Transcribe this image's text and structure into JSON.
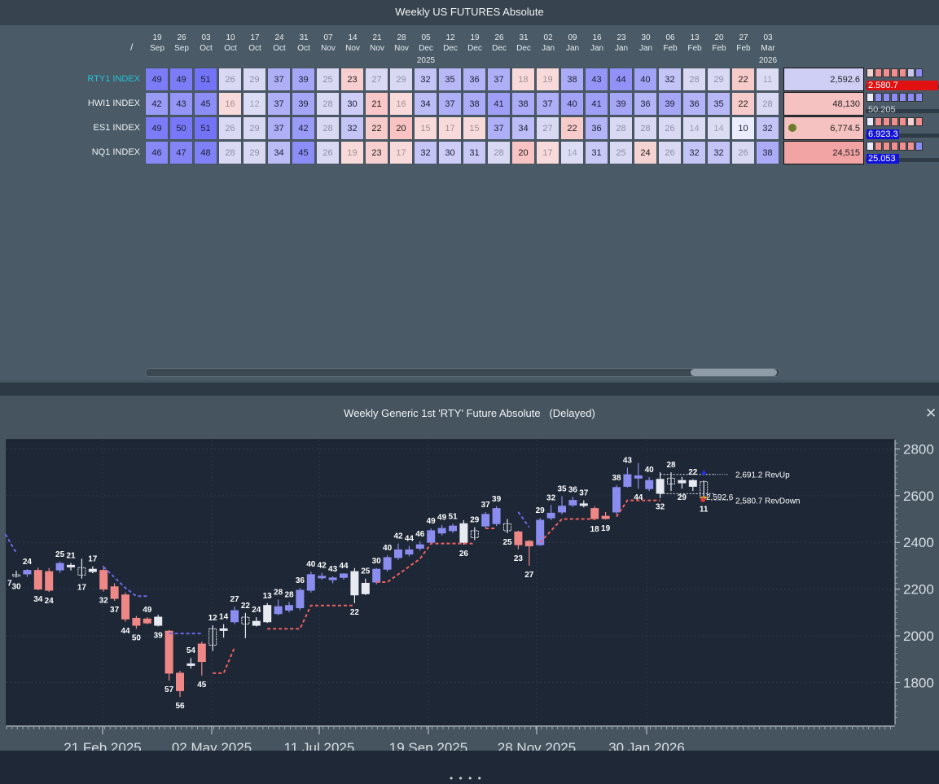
{
  "grid_title": "Weekly US FUTURES Absolute",
  "slash": "/",
  "columns": [
    {
      "day": "19",
      "mon": "Sep"
    },
    {
      "day": "26",
      "mon": "Sep"
    },
    {
      "day": "03",
      "mon": "Oct"
    },
    {
      "day": "10",
      "mon": "Oct"
    },
    {
      "day": "17",
      "mon": "Oct"
    },
    {
      "day": "24",
      "mon": "Oct"
    },
    {
      "day": "31",
      "mon": "Oct"
    },
    {
      "day": "07",
      "mon": "Nov"
    },
    {
      "day": "14",
      "mon": "Nov"
    },
    {
      "day": "21",
      "mon": "Nov"
    },
    {
      "day": "28",
      "mon": "Nov"
    },
    {
      "day": "05",
      "mon": "Dec"
    },
    {
      "day": "12",
      "mon": "Dec"
    },
    {
      "day": "19",
      "mon": "Dec"
    },
    {
      "day": "26",
      "mon": "Dec"
    },
    {
      "day": "31",
      "mon": "Dec"
    },
    {
      "day": "02",
      "mon": "Jan"
    },
    {
      "day": "09",
      "mon": "Jan"
    },
    {
      "day": "16",
      "mon": "Jan"
    },
    {
      "day": "23",
      "mon": "Jan"
    },
    {
      "day": "30",
      "mon": "Jan"
    },
    {
      "day": "06",
      "mon": "Feb"
    },
    {
      "day": "13",
      "mon": "Feb"
    },
    {
      "day": "20",
      "mon": "Feb"
    },
    {
      "day": "27",
      "mon": "Feb"
    },
    {
      "day": "03",
      "mon": "Mar"
    }
  ],
  "year_labels": [
    {
      "col": 11,
      "text": "2025"
    },
    {
      "col": 25,
      "text": "2026"
    }
  ],
  "rows": [
    {
      "name": "RTY1 INDEX",
      "highlight": true,
      "values": [
        49,
        49,
        51,
        26,
        29,
        37,
        39,
        25,
        23,
        27,
        29,
        32,
        35,
        36,
        37,
        18,
        19,
        38,
        43,
        44,
        40,
        32,
        28,
        29,
        22,
        11
      ],
      "last": "2,592.6",
      "sub": "2.580.7",
      "sub_bg": "#e11111",
      "mini": [
        "#f3d2d2",
        "#ef8f8f",
        "#ef8f8f",
        "#ef8f8f",
        "#ef8f8f",
        "#c8c8ee",
        "#8c8cf2"
      ],
      "dot": false,
      "box_bg": "#cfcff5"
    },
    {
      "name": "HWI1 INDEX",
      "highlight": false,
      "values": [
        42,
        43,
        45,
        16,
        12,
        37,
        39,
        28,
        30,
        21,
        16,
        34,
        37,
        38,
        41,
        38,
        37,
        40,
        41,
        39,
        36,
        39,
        36,
        35,
        22,
        28
      ],
      "last": "48,130",
      "sub": "50.205",
      "sub_bg": "",
      "mini": [
        "#ebebff",
        "#8c8cf2",
        "#8c8cf2",
        "#8c8cf2",
        "#8c8cf2",
        "#8c8cf2",
        "#8c8cf2"
      ],
      "dot": false,
      "box_bg": "#f6c1c1"
    },
    {
      "name": "ES1 INDEX",
      "highlight": false,
      "values": [
        49,
        50,
        51,
        26,
        29,
        37,
        42,
        28,
        32,
        22,
        20,
        15,
        17,
        15,
        37,
        34,
        27,
        22,
        36,
        28,
        28,
        26,
        14,
        14,
        10,
        32
      ],
      "last": "6,774.5",
      "sub": "6.923.3",
      "sub_bg": "#1111dd",
      "mini": [
        "#ebebff",
        "#ef8f8f",
        "#ef8f8f",
        "#ef8f8f",
        "#ef8f8f",
        "#f3d2d2",
        "#ef8f8f"
      ],
      "dot": true,
      "box_bg": "#f6c1c1"
    },
    {
      "name": "NQ1 INDEX",
      "highlight": false,
      "values": [
        46,
        47,
        48,
        28,
        29,
        34,
        45,
        26,
        19,
        23,
        17,
        32,
        30,
        31,
        28,
        20,
        17,
        14,
        31,
        25,
        24,
        26,
        32,
        32,
        26,
        38
      ],
      "last": "24,515",
      "sub": "25.053",
      "sub_bg": "#1111dd",
      "mini": [
        "#ebebff",
        "#ef8f8f",
        "#ef8f8f",
        "#ef8f8f",
        "#ef8f8f",
        "#ef8f8f",
        "#8c8cf2"
      ],
      "dot": false,
      "box_bg": "#f2a3a3"
    }
  ],
  "chart_title": "Weekly Generic 1st 'RTY' Future Absolute   (Delayed)",
  "close_glyph": "✕",
  "chart_data": {
    "type": "candlestick",
    "ylim": [
      1620,
      2840
    ],
    "yticks": [
      1800,
      2000,
      2200,
      2400,
      2600,
      2800
    ],
    "xticks": [
      "21 Feb 2025",
      "02 May 2025",
      "11 Jul 2025",
      "19 Sep 2025",
      "28 Nov 2025",
      "30 Jan 2026"
    ],
    "candles": [
      {
        "o": 2262,
        "h": 2278,
        "l": 2250,
        "c": 2258,
        "col": "w",
        "lbl": "30"
      },
      {
        "o": 2265,
        "h": 2285,
        "l": 2252,
        "c": 2280,
        "col": "p",
        "lbl": "24"
      },
      {
        "o": 2280,
        "h": 2292,
        "l": 2195,
        "c": 2200,
        "col": "r",
        "lbl": "34"
      },
      {
        "o": 2275,
        "h": 2290,
        "l": 2188,
        "c": 2195,
        "col": "r",
        "lbl": "24"
      },
      {
        "o": 2282,
        "h": 2318,
        "l": 2270,
        "c": 2310,
        "col": "p",
        "lbl": "25"
      },
      {
        "o": 2298,
        "h": 2312,
        "l": 2280,
        "c": 2302,
        "col": "w",
        "lbl": "21"
      },
      {
        "o": 2292,
        "h": 2330,
        "l": 2245,
        "c": 2260,
        "col": "w",
        "lbl": "17"
      },
      {
        "o": 2275,
        "h": 2298,
        "l": 2268,
        "c": 2285,
        "col": "w",
        "lbl": "17"
      },
      {
        "o": 2280,
        "h": 2300,
        "l": 2190,
        "c": 2200,
        "col": "r",
        "lbl": "32"
      },
      {
        "o": 2210,
        "h": 2225,
        "l": 2150,
        "c": 2160,
        "col": "r",
        "lbl": "37"
      },
      {
        "o": 2175,
        "h": 2185,
        "l": 2060,
        "c": 2072,
        "col": "r",
        "lbl": "44"
      },
      {
        "o": 2075,
        "h": 2085,
        "l": 2030,
        "c": 2045,
        "col": "r",
        "lbl": "50"
      },
      {
        "o": 2055,
        "h": 2080,
        "l": 2050,
        "c": 2072,
        "col": "r",
        "lbl": "49"
      },
      {
        "o": 2080,
        "h": 2090,
        "l": 2040,
        "c": 2045,
        "col": "w",
        "lbl": "39"
      },
      {
        "o": 2020,
        "h": 2025,
        "l": 1808,
        "c": 1840,
        "col": "r",
        "lbl": "57"
      },
      {
        "o": 1840,
        "h": 1850,
        "l": 1738,
        "c": 1765,
        "col": "r",
        "lbl": "56"
      },
      {
        "o": 1880,
        "h": 1905,
        "l": 1860,
        "c": 1880,
        "col": "w",
        "lbl": "54"
      },
      {
        "o": 1965,
        "h": 1975,
        "l": 1830,
        "c": 1890,
        "col": "r",
        "lbl": "45"
      },
      {
        "o": 1960,
        "h": 2045,
        "l": 1935,
        "c": 2030,
        "col": "w",
        "lbl": "12"
      },
      {
        "o": 2030,
        "h": 2050,
        "l": 1992,
        "c": 2030,
        "col": "w",
        "lbl": "14"
      },
      {
        "o": 2060,
        "h": 2125,
        "l": 2050,
        "c": 2108,
        "col": "p",
        "lbl": "27"
      },
      {
        "o": 2050,
        "h": 2098,
        "l": 1990,
        "c": 2080,
        "col": "w",
        "lbl": "22"
      },
      {
        "o": 2045,
        "h": 2080,
        "l": 2040,
        "c": 2062,
        "col": "w",
        "lbl": "24"
      },
      {
        "o": 2060,
        "h": 2140,
        "l": 2055,
        "c": 2130,
        "col": "w",
        "lbl": "13"
      },
      {
        "o": 2095,
        "h": 2155,
        "l": 2088,
        "c": 2125,
        "col": "p",
        "lbl": "28"
      },
      {
        "o": 2110,
        "h": 2145,
        "l": 2100,
        "c": 2130,
        "col": "p",
        "lbl": "28"
      },
      {
        "o": 2120,
        "h": 2205,
        "l": 2110,
        "c": 2195,
        "col": "p",
        "lbl": "36"
      },
      {
        "o": 2195,
        "h": 2275,
        "l": 2185,
        "c": 2262,
        "col": "p",
        "lbl": "40"
      },
      {
        "o": 2250,
        "h": 2270,
        "l": 2240,
        "c": 2255,
        "col": "p",
        "lbl": "42"
      },
      {
        "o": 2240,
        "h": 2255,
        "l": 2225,
        "c": 2248,
        "col": "p",
        "lbl": "43"
      },
      {
        "o": 2250,
        "h": 2268,
        "l": 2240,
        "c": 2265,
        "col": "p",
        "lbl": "44"
      },
      {
        "o": 2275,
        "h": 2290,
        "l": 2140,
        "c": 2175,
        "col": "w",
        "lbl": "22"
      },
      {
        "o": 2180,
        "h": 2245,
        "l": 2175,
        "c": 2225,
        "col": "w",
        "lbl": "25"
      },
      {
        "o": 2230,
        "h": 2290,
        "l": 2220,
        "c": 2285,
        "col": "p",
        "lbl": "30"
      },
      {
        "o": 2285,
        "h": 2345,
        "l": 2275,
        "c": 2335,
        "col": "p",
        "lbl": "40"
      },
      {
        "o": 2335,
        "h": 2395,
        "l": 2325,
        "c": 2368,
        "col": "p",
        "lbl": "42"
      },
      {
        "o": 2350,
        "h": 2385,
        "l": 2340,
        "c": 2368,
        "col": "p",
        "lbl": "44"
      },
      {
        "o": 2375,
        "h": 2405,
        "l": 2365,
        "c": 2390,
        "col": "p",
        "lbl": "46"
      },
      {
        "o": 2400,
        "h": 2460,
        "l": 2395,
        "c": 2450,
        "col": "p",
        "lbl": "49"
      },
      {
        "o": 2440,
        "h": 2475,
        "l": 2430,
        "c": 2460,
        "col": "p",
        "lbl": "49"
      },
      {
        "o": 2450,
        "h": 2480,
        "l": 2440,
        "c": 2470,
        "col": "p",
        "lbl": "51"
      },
      {
        "o": 2480,
        "h": 2495,
        "l": 2390,
        "c": 2400,
        "col": "w",
        "lbl": "26"
      },
      {
        "o": 2420,
        "h": 2465,
        "l": 2410,
        "c": 2450,
        "col": "w",
        "lbl": "29"
      },
      {
        "o": 2470,
        "h": 2530,
        "l": 2460,
        "c": 2520,
        "col": "p",
        "lbl": "37"
      },
      {
        "o": 2480,
        "h": 2555,
        "l": 2470,
        "c": 2545,
        "col": "p",
        "lbl": "39"
      },
      {
        "o": 2480,
        "h": 2500,
        "l": 2440,
        "c": 2450,
        "col": "w",
        "lbl": "25"
      },
      {
        "o": 2445,
        "h": 2450,
        "l": 2370,
        "c": 2390,
        "col": "r",
        "lbl": "23"
      },
      {
        "o": 2405,
        "h": 2410,
        "l": 2300,
        "c": 2385,
        "col": "r",
        "lbl": "27"
      },
      {
        "o": 2390,
        "h": 2505,
        "l": 2385,
        "c": 2495,
        "col": "p",
        "lbl": "29"
      },
      {
        "o": 2505,
        "h": 2560,
        "l": 2495,
        "c": 2525,
        "col": "p",
        "lbl": "32"
      },
      {
        "o": 2530,
        "h": 2598,
        "l": 2520,
        "c": 2555,
        "col": "p",
        "lbl": "35"
      },
      {
        "o": 2560,
        "h": 2595,
        "l": 2552,
        "c": 2580,
        "col": "p",
        "lbl": "36"
      },
      {
        "o": 2560,
        "h": 2580,
        "l": 2550,
        "c": 2565,
        "col": "w",
        "lbl": "37"
      },
      {
        "o": 2545,
        "h": 2555,
        "l": 2495,
        "c": 2502,
        "col": "r",
        "lbl": "18"
      },
      {
        "o": 2512,
        "h": 2530,
        "l": 2498,
        "c": 2502,
        "col": "r",
        "lbl": "19"
      },
      {
        "o": 2530,
        "h": 2645,
        "l": 2520,
        "c": 2635,
        "col": "p",
        "lbl": "38"
      },
      {
        "o": 2640,
        "h": 2720,
        "l": 2635,
        "c": 2690,
        "col": "p",
        "lbl": "43"
      },
      {
        "o": 2685,
        "h": 2740,
        "l": 2630,
        "c": 2675,
        "col": "p",
        "lbl": "44"
      },
      {
        "o": 2630,
        "h": 2680,
        "l": 2620,
        "c": 2665,
        "col": "p",
        "lbl": "40"
      },
      {
        "o": 2670,
        "h": 2700,
        "l": 2590,
        "c": 2610,
        "col": "w",
        "lbl": "32"
      },
      {
        "o": 2650,
        "h": 2700,
        "l": 2620,
        "c": 2675,
        "col": "w",
        "lbl": "28"
      },
      {
        "o": 2665,
        "h": 2680,
        "l": 2630,
        "c": 2655,
        "col": "w",
        "lbl": "29"
      },
      {
        "o": 2640,
        "h": 2670,
        "l": 2620,
        "c": 2665,
        "col": "w",
        "lbl": "22"
      },
      {
        "o": 2660,
        "h": 2665,
        "l": 2580,
        "c": 2592.6,
        "col": "w",
        "lbl": "11"
      }
    ],
    "annotations": [
      {
        "text": "2,691.2 RevUp",
        "value": 2691.2
      },
      {
        "text": "2,592.6",
        "value": 2592.6
      },
      {
        "text": "2,580.7 RevDown",
        "value": 2580.7
      }
    ],
    "first_label": "7"
  }
}
